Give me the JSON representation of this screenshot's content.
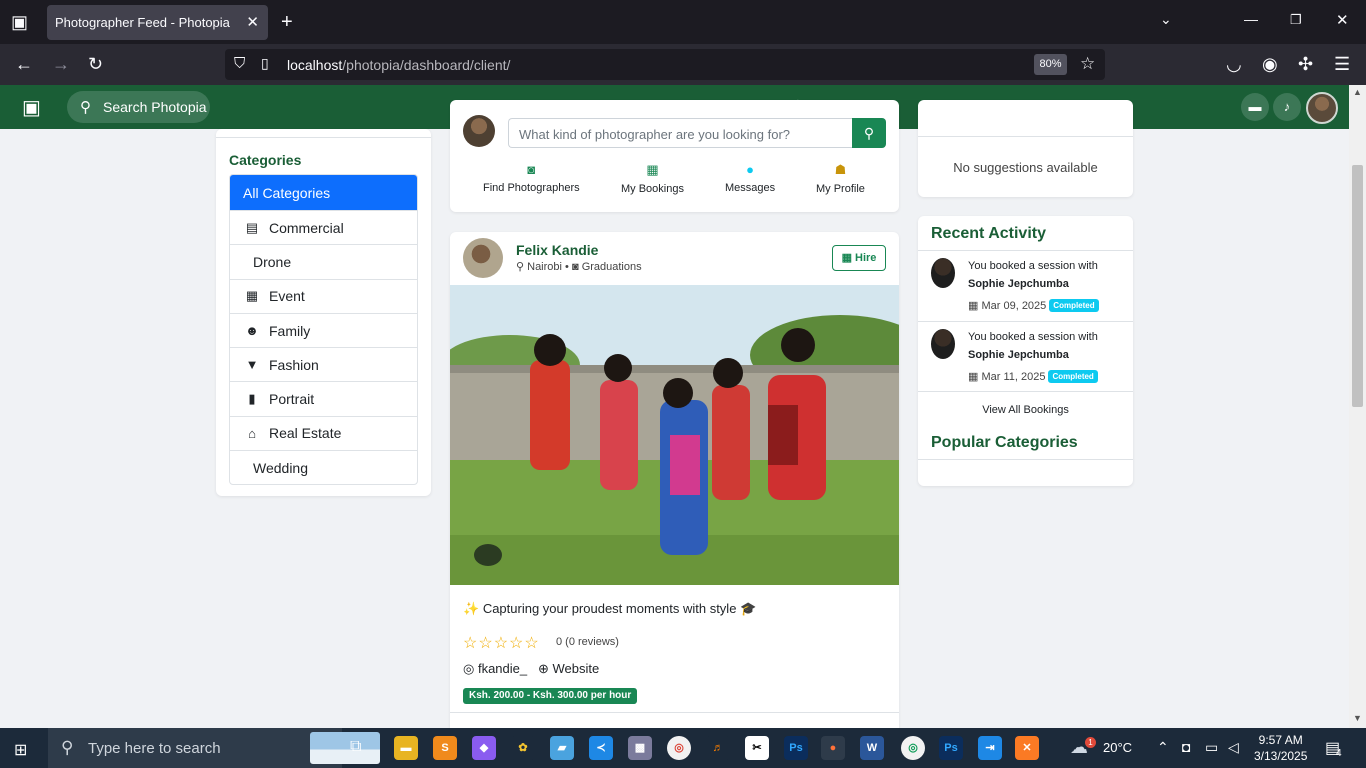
{
  "browser": {
    "tab_title": "Photographer Feed - Photopia",
    "url_host": "localhost",
    "url_path": "/photopia/dashboard/client/",
    "zoom": "80%"
  },
  "header": {
    "search_label": "Search Photopia",
    "nav_icons": [
      "home-icon",
      "calendar-icon",
      "camera-icon",
      "heart-icon",
      "star-icon"
    ],
    "brand_color": "#1a5e36"
  },
  "categories": {
    "title": "Categories",
    "items": [
      {
        "label": "All Categories",
        "icon": ""
      },
      {
        "label": "Commercial",
        "icon": "store-icon"
      },
      {
        "label": "Drone",
        "icon": ""
      },
      {
        "label": "Event",
        "icon": "calendar-check-icon"
      },
      {
        "label": "Family",
        "icon": "users-icon"
      },
      {
        "label": "Fashion",
        "icon": "shirt-icon"
      },
      {
        "label": "Portrait",
        "icon": "portrait-icon"
      },
      {
        "label": "Real Estate",
        "icon": "house-icon"
      },
      {
        "label": "Wedding",
        "icon": ""
      }
    ]
  },
  "search": {
    "placeholder": "What kind of photographer are you looking for?",
    "quick_links": [
      {
        "label": "Find Photographers",
        "icon": "camera-icon",
        "color": "#198754"
      },
      {
        "label": "My Bookings",
        "icon": "calendar-check-icon",
        "color": "#198754"
      },
      {
        "label": "Messages",
        "icon": "chat-icon",
        "color": "#0dcaf0"
      },
      {
        "label": "My Profile",
        "icon": "user-icon",
        "color": "#c8940a"
      }
    ]
  },
  "post": {
    "name": "Felix Kandie",
    "location": "Nairobi",
    "specialty": "Graduations",
    "hire_label": "Hire",
    "caption": "Capturing your proudest moments with style",
    "rating_text": "0 (0 reviews)",
    "instagram": "fkandie_",
    "website": "Website",
    "price": "Ksh. 200.00 - Ksh. 300.00 per hour"
  },
  "suggestions": {
    "empty_text": "No suggestions available"
  },
  "recent_activity": {
    "title": "Recent Activity",
    "items": [
      {
        "text": "You booked a session with",
        "who": "Sophie Jepchumba",
        "date": "Mar 09, 2025",
        "status": "Completed"
      },
      {
        "text": "You booked a session with",
        "who": "Sophie Jepchumba",
        "date": "Mar 11, 2025",
        "status": "Completed"
      }
    ],
    "view_all": "View All Bookings"
  },
  "popular_categories": {
    "title": "Popular Categories"
  },
  "taskbar": {
    "search_placeholder": "Type here to search",
    "weather": "20°C",
    "time": "9:57 AM",
    "date": "3/13/2025",
    "notifications": "4",
    "weather_badge": "1"
  }
}
